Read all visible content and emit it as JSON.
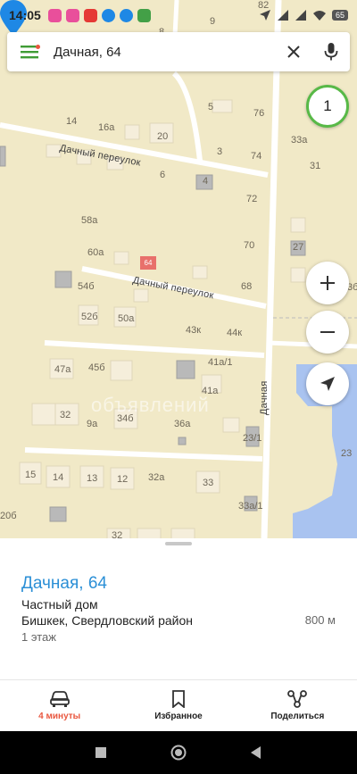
{
  "status": {
    "time": "14:05",
    "battery": "65"
  },
  "search": {
    "query": "Дачная, 64"
  },
  "map": {
    "layer_badge": "1",
    "watermark": "объявлений",
    "streets": {
      "top_lane": "Дачный переулок",
      "mid_lane": "Дачный переулок",
      "main_road": "Дачная"
    },
    "pin_label": "64",
    "house_numbers": [
      "82",
      "9",
      "8",
      "5",
      "76",
      "14",
      "16а",
      "20",
      "33а",
      "3",
      "74",
      "31",
      "6",
      "4",
      "72",
      "58а",
      "60а",
      "70",
      "27",
      "54б",
      "68",
      "3б",
      "52б",
      "50а",
      "43к",
      "44к",
      "47а",
      "45б",
      "41а/1",
      "41а",
      "32",
      "9а",
      "34б",
      "36а",
      "23/1",
      "23",
      "15",
      "14",
      "13",
      "12",
      "32а",
      "33",
      "20б",
      "33а/1",
      "32"
    ]
  },
  "place": {
    "title": "Дачная, 64",
    "type": "Частный дом",
    "address": "Бишкек, Свердловский район",
    "distance": "800 м",
    "floors": "1 этаж"
  },
  "actions": [
    {
      "label": "4 минуты",
      "icon": "car-icon"
    },
    {
      "label": "Избранное",
      "icon": "bookmark-icon"
    },
    {
      "label": "Поделиться",
      "icon": "share-icon"
    }
  ],
  "colors": {
    "accent": "#e9573f",
    "link": "#2b8fd6",
    "map_bg": "#f1e9c7",
    "layer_ring": "#58b947",
    "pin": "#1e88e5"
  }
}
